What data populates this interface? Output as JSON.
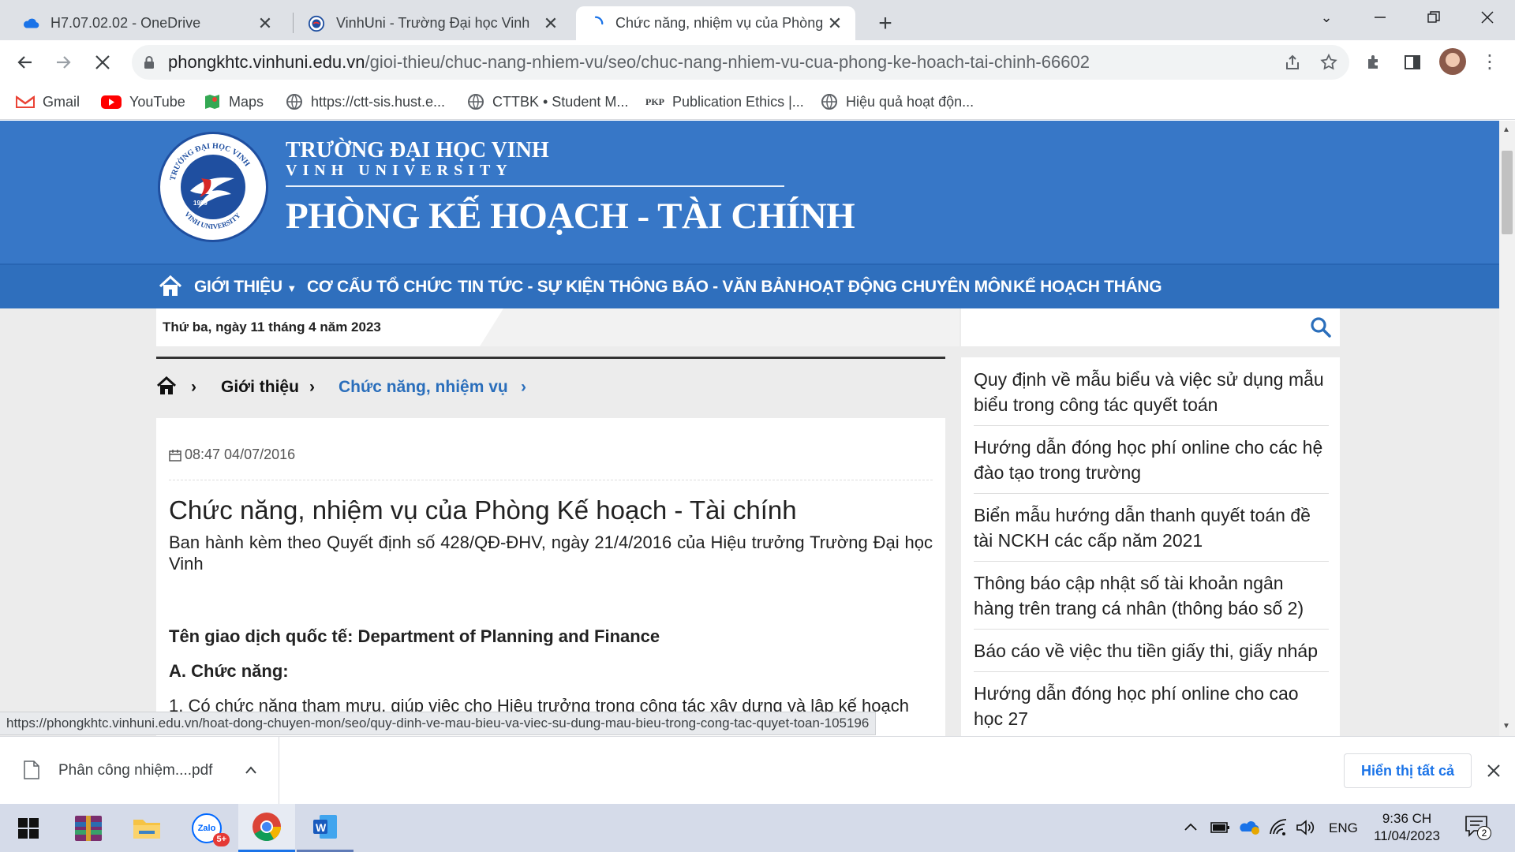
{
  "tabs": [
    {
      "title": "H7.07.02.02 - OneDrive",
      "icon": "onedrive-icon"
    },
    {
      "title": "VinhUni - Trường Đại học Vinh",
      "icon": "vinhuni-icon"
    },
    {
      "title": "Chức năng, nhiệm vụ của Phòng",
      "icon": "loading-spinner-icon"
    }
  ],
  "address": {
    "host": "phongkhtc.vinhuni.edu.vn",
    "path": "/gioi-thieu/chuc-nang-nhiem-vu/seo/chuc-nang-nhiem-vu-cua-phong-ke-hoach-tai-chinh-66602"
  },
  "bookmarks": [
    {
      "label": "Gmail",
      "icon": "gmail-icon"
    },
    {
      "label": "YouTube",
      "icon": "youtube-icon"
    },
    {
      "label": "Maps",
      "icon": "maps-icon"
    },
    {
      "label": "https://ctt-sis.hust.e...",
      "icon": "globe-icon"
    },
    {
      "label": "CTTBK • Student M...",
      "icon": "globe-icon"
    },
    {
      "label": "Publication Ethics |...",
      "icon": "pkp-icon",
      "badge": "PKP"
    },
    {
      "label": "Hiệu quả hoạt độn...",
      "icon": "globe-icon"
    }
  ],
  "banner": {
    "logo_text_top": "TRƯỜNG ĐẠI HỌC VINH",
    "logo_text_bottom": "VINH UNIVERSITY",
    "logo_year": "1959",
    "school_name": "TRƯỜNG ĐẠI HỌC VINH",
    "school_name_en": "VINH UNIVERSITY",
    "department": "PHÒNG KẾ HOẠCH - TÀI CHÍNH"
  },
  "nav": [
    {
      "label": "GIỚI THIỆU"
    },
    {
      "label": "CƠ CẤU TỔ CHỨC"
    },
    {
      "label": "TIN TỨC - SỰ KIỆN"
    },
    {
      "label": "THÔNG BÁO - VĂN BẢN"
    },
    {
      "label": "HOẠT ĐỘNG CHUYÊN MÔN"
    },
    {
      "label": "KẾ HOẠCH THÁNG"
    }
  ],
  "date_text": "Thứ ba, ngày 11 tháng 4 năm 2023",
  "breadcrumb": {
    "level1": "Giới thiệu",
    "level2": "Chức năng, nhiệm vụ"
  },
  "article": {
    "datetime": "08:47 04/07/2016",
    "title": "Chức năng, nhiệm vụ của Phòng Kế hoạch - Tài chính",
    "subtitle": "Ban hành kèm theo Quyết định số 428/QĐ-ĐHV, ngày 21/4/2016 của Hiệu trưởng Trường Đại học Vinh",
    "intl_name": "Tên giao dịch quốc tế: Department of Planning and Finance",
    "section_a": "A. Chức năng:",
    "para1": "1. Có chức năng tham mưu, giúp việc cho Hiệu trưởng trong công tác xây dựng và lập kế hoạch"
  },
  "sidebar": [
    "Quy định về mẫu biểu và việc sử dụng mẫu biểu trong công tác quyết toán",
    "Hướng dẫn đóng học phí online cho các hệ đào tạo trong trường",
    "Biển mẫu hướng dẫn thanh quyết toán đề tài NCKH các cấp năm 2021",
    "Thông báo cập nhật số tài khoản ngân hàng trên trang cá nhân (thông báo số 2)",
    "Báo cáo về việc thu tiền giấy thi, giấy nháp",
    "Hướng dẫn đóng học phí online cho cao học 27"
  ],
  "status_url": "https://phongkhtc.vinhuni.edu.vn/hoat-dong-chuyen-mon/seo/quy-dinh-ve-mau-bieu-va-viec-su-dung-mau-bieu-trong-cong-tac-quyet-toan-105196",
  "download": {
    "filename": "Phân công nhiệm....pdf",
    "show_all": "Hiển thị tất cả"
  },
  "taskbar": {
    "lang": "ENG",
    "time": "9:36 CH",
    "date": "11/04/2023",
    "notif_count": "2",
    "zalo_badge": "5+"
  },
  "colors": {
    "banner": "#3777c7",
    "nav": "#2f6fbd",
    "link": "#2a6ebb"
  }
}
